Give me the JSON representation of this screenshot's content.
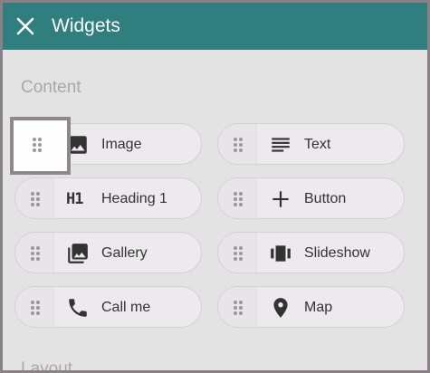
{
  "header": {
    "title": "Widgets",
    "close_icon": "close-icon"
  },
  "sections": {
    "content": {
      "title": "Content"
    },
    "layout": {
      "title": "Layout"
    }
  },
  "widgets": [
    {
      "label": "Image",
      "icon": "image-icon"
    },
    {
      "label": "Text",
      "icon": "text-lines-icon"
    },
    {
      "label": "Heading 1",
      "icon": "heading-icon",
      "icon_text": "H1"
    },
    {
      "label": "Button",
      "icon": "plus-icon"
    },
    {
      "label": "Gallery",
      "icon": "gallery-icon"
    },
    {
      "label": "Slideshow",
      "icon": "slideshow-icon"
    },
    {
      "label": "Call me",
      "icon": "phone-icon"
    },
    {
      "label": "Map",
      "icon": "map-pin-icon"
    }
  ],
  "colors": {
    "header_bg": "#2f7f7f",
    "panel_bg": "#e4e3e4",
    "pill_bg": "#eceaec",
    "section_title": "#a9a7a9",
    "text": "#333333",
    "highlight_border": "#8f868e"
  }
}
